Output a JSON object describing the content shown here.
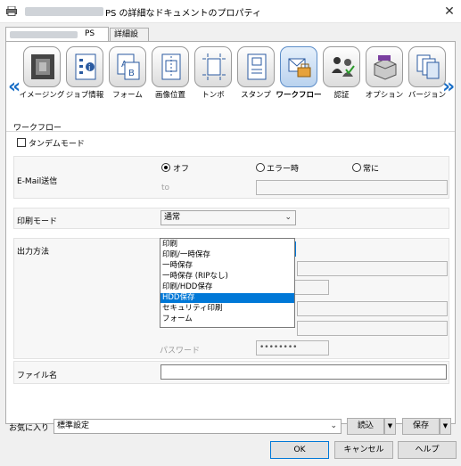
{
  "window": {
    "title": "PS の詳細なドキュメントのプロパティ",
    "close_label": "✕"
  },
  "tabs": [
    {
      "label": "PS"
    },
    {
      "label": "詳細設定"
    }
  ],
  "toolbar": {
    "left_arrow": "«",
    "right_arrow": "»",
    "items": [
      {
        "label": "イメージング",
        "icon": "imaging-icon"
      },
      {
        "label": "ジョブ情報",
        "icon": "job-info-icon"
      },
      {
        "label": "フォーム",
        "icon": "form-icon"
      },
      {
        "label": "画像位置",
        "icon": "image-position-icon"
      },
      {
        "label": "トンボ",
        "icon": "crop-marks-icon"
      },
      {
        "label": "スタンプ",
        "icon": "stamp-icon"
      },
      {
        "label": "ワークフロー",
        "icon": "workflow-icon",
        "selected": true
      },
      {
        "label": "認証",
        "icon": "authentication-icon"
      },
      {
        "label": "オプション",
        "icon": "option-icon"
      },
      {
        "label": "バージョン",
        "icon": "version-icon"
      }
    ]
  },
  "workflow": {
    "section_title": "ワークフロー",
    "tandem_mode": {
      "label": "タンデムモード",
      "checked": false
    },
    "email": {
      "label": "E-Mail送信",
      "options": [
        "オフ",
        "エラー時",
        "常に"
      ],
      "selected": "オフ",
      "to_label": "to",
      "to_value": ""
    },
    "print_mode": {
      "label": "印刷モード",
      "value": "通常"
    },
    "output_method": {
      "label": "出力方法",
      "value": "印刷",
      "options": [
        "印刷",
        "印刷/一時保存",
        "一時保存",
        "一時保存 (RIPなし)",
        "印刷/HDD保存",
        "HDD保存",
        "セキュリティ印刷",
        "フォーム"
      ],
      "highlighted": "HDD保存"
    },
    "password": {
      "label": "パスワード",
      "value": "••••••••"
    },
    "filename": {
      "label": "ファイル名",
      "value": ""
    }
  },
  "favorites": {
    "label": "お気に入り",
    "value": "標準設定",
    "load_label": "読込",
    "save_label": "保存"
  },
  "buttons": {
    "ok": "OK",
    "cancel": "キャンセル",
    "help": "ヘルプ"
  }
}
